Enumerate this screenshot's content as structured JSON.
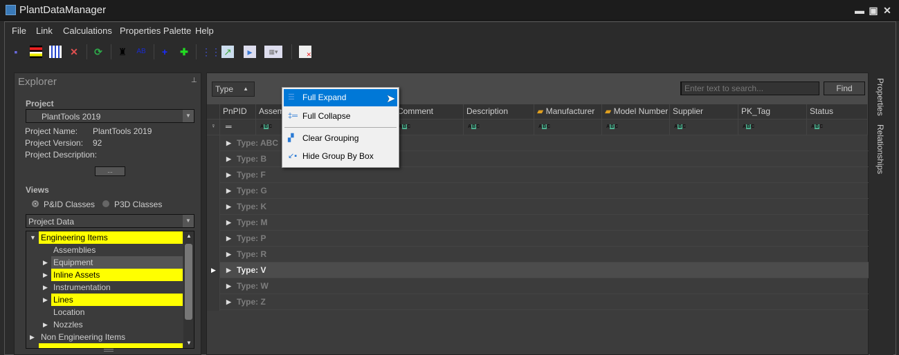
{
  "window": {
    "title": "PlantDataManager"
  },
  "menu": [
    "File",
    "Link",
    "Calculations",
    "Properties Palette",
    "Help"
  ],
  "toolbar": [
    "save-icon",
    "columns-icon",
    "rows-icon",
    "delete-icon",
    "refresh-icon",
    "find-icon",
    "find-replace-icon",
    "add-icon",
    "add-item-icon",
    "link-icon",
    "export-icon",
    "import-icon",
    "grid-view-icon",
    "close-document-icon"
  ],
  "explorer": {
    "title": "Explorer",
    "project_heading": "Project",
    "project_select": "PlantTools 2019",
    "name_label": "Project Name:",
    "name_value": "PlantTools 2019",
    "version_label": "Project Version:",
    "version_value": "92",
    "description_label": "Project Description:",
    "more_button": "...",
    "views_heading": "Views",
    "radio_pid": "P&ID Classes",
    "radio_p3d": "P3D Classes",
    "selected_view": "P&ID Classes",
    "data_select": "Project Data",
    "tree": [
      {
        "label": "Engineering Items",
        "highlight": true
      },
      {
        "label": "Assemblies"
      },
      {
        "label": "Equipment",
        "selected": true
      },
      {
        "label": "Inline Assets",
        "highlight": true
      },
      {
        "label": "Instrumentation"
      },
      {
        "label": "Lines",
        "highlight": true
      },
      {
        "label": "Location"
      },
      {
        "label": "Nozzles"
      },
      {
        "label": "Non Engineering Items"
      }
    ]
  },
  "grid": {
    "group_by": "Type",
    "search_placeholder": "Enter text to search...",
    "find_button": "Find",
    "columns": [
      "PnPID",
      "Assembly",
      "Comment",
      "Description",
      "Manufacturer",
      "Model Number",
      "Supplier",
      "PK_Tag",
      "Status"
    ],
    "groups": [
      "Type: ABC",
      "Type: B",
      "Type: F",
      "Type: G",
      "Type: K",
      "Type: M",
      "Type: P",
      "Type: R",
      "Type: V",
      "Type: W",
      "Type: Z"
    ],
    "current_group": "Type: V"
  },
  "context_menu": [
    {
      "label": "Full Expand",
      "icon": "expand-icon",
      "highlighted": true
    },
    {
      "label": "Full Collapse",
      "icon": "collapse-icon"
    },
    {
      "label": "Clear Grouping",
      "icon": "clear-grouping-icon"
    },
    {
      "label": "Hide Group By Box",
      "icon": "hide-group-box-icon"
    }
  ],
  "side_tabs": [
    "Properties",
    "Relationships"
  ],
  "colors": {
    "highlight": "#ffff00",
    "menu_selection": "#0078d7"
  }
}
